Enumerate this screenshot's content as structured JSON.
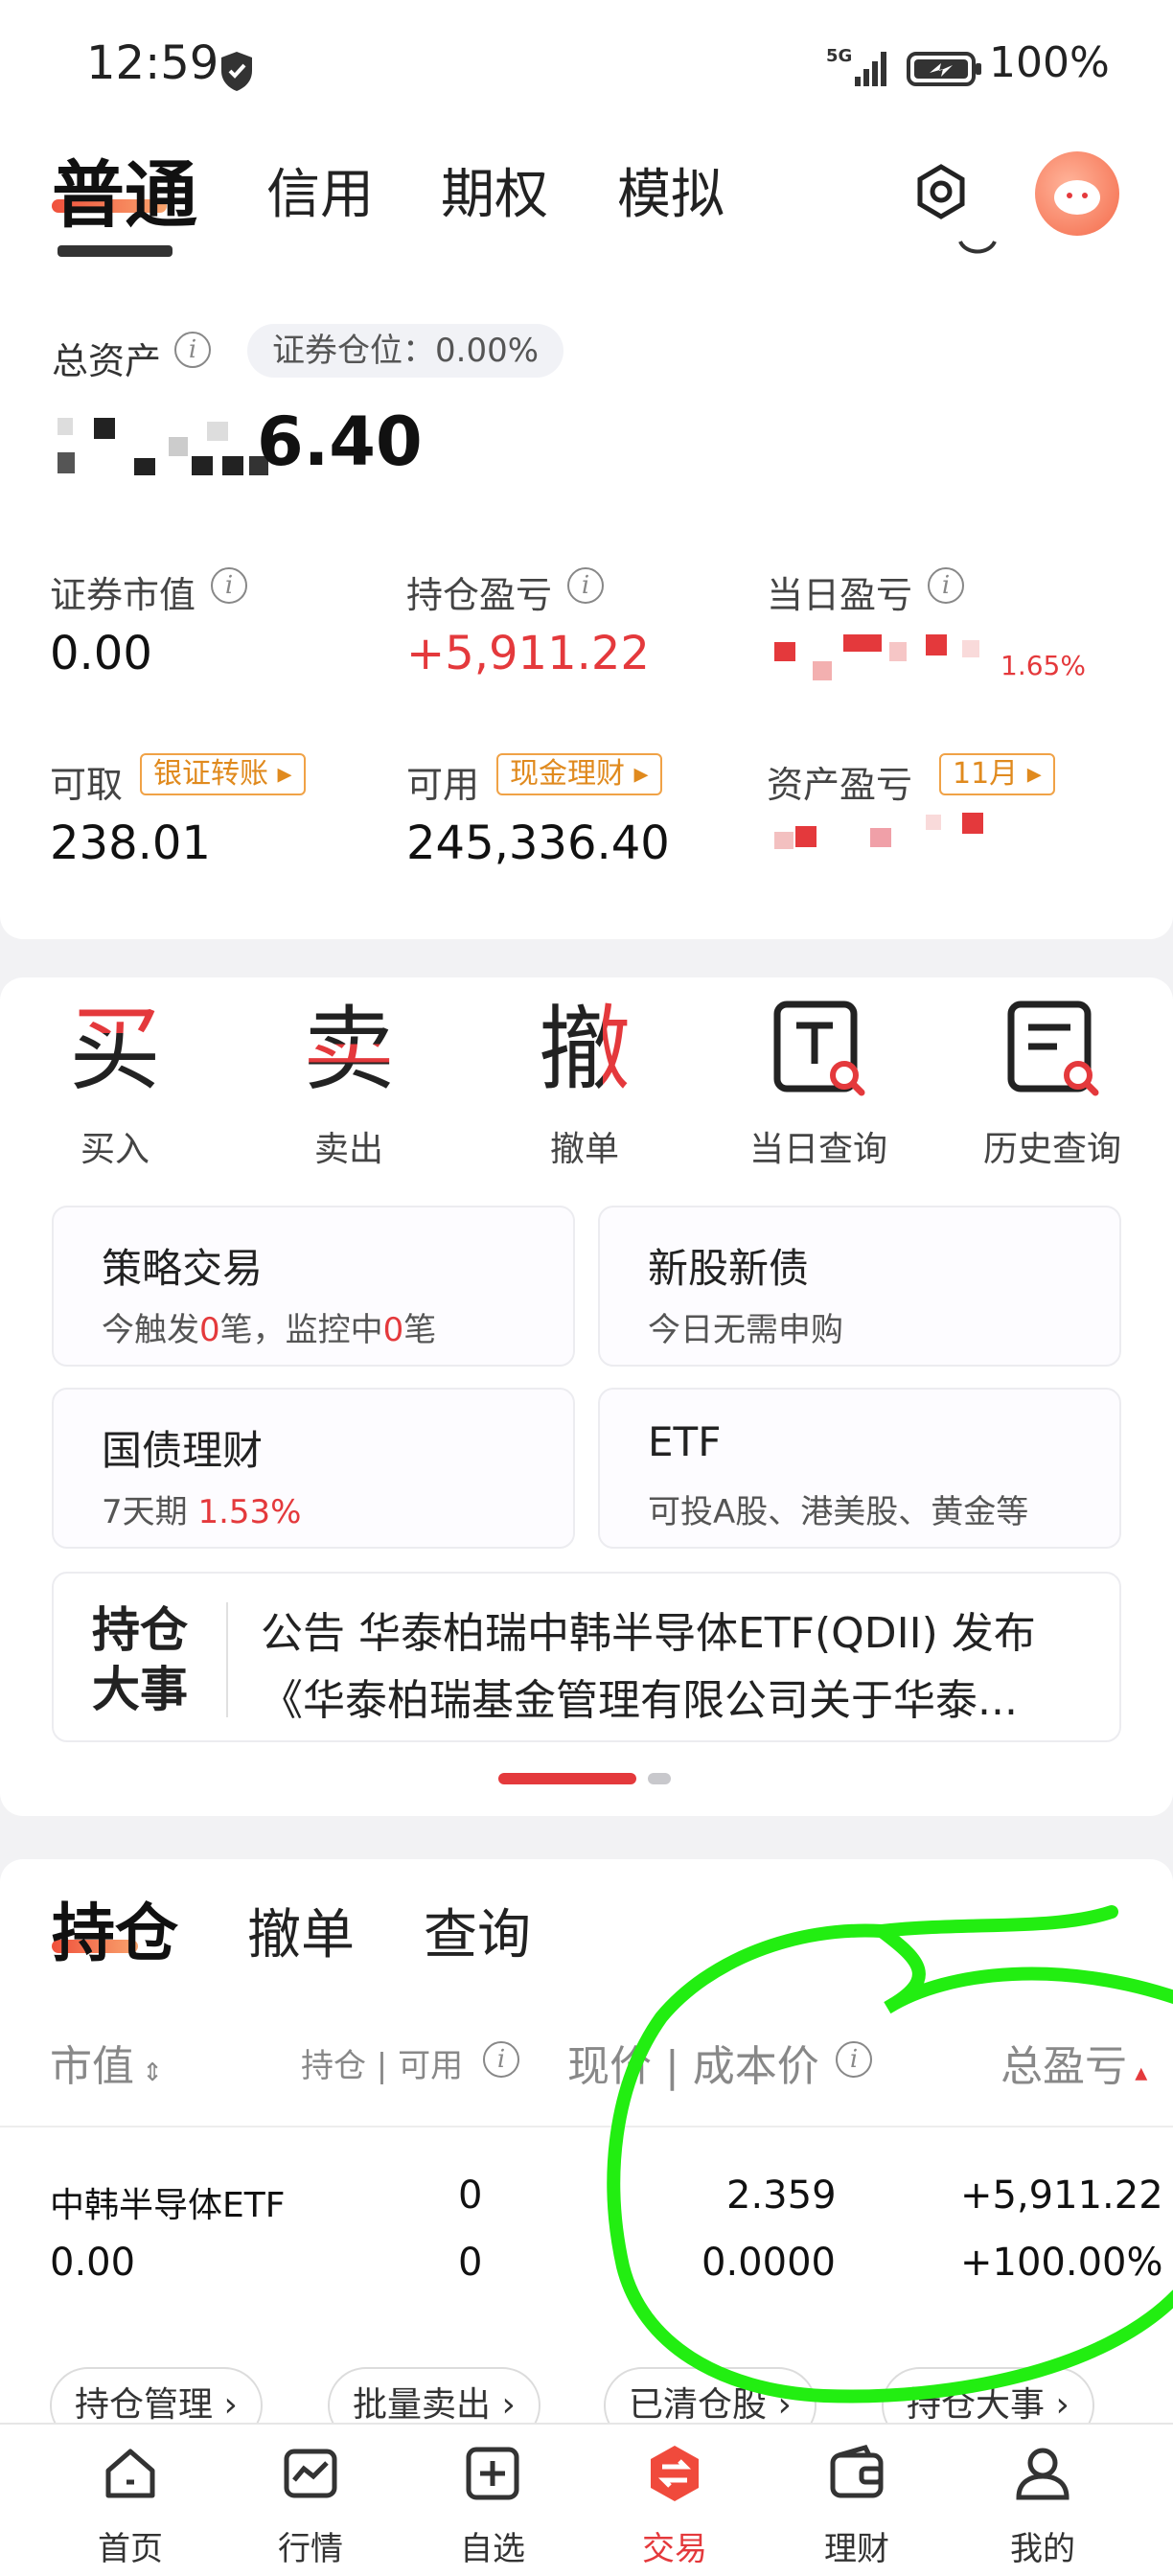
{
  "status_bar": {
    "time": "12:59",
    "network": "5G",
    "battery": "100%"
  },
  "top_tabs": [
    "普通",
    "信用",
    "期权",
    "模拟"
  ],
  "assets": {
    "total_label": "总资产",
    "position_pill": "证券仓位：0.00%",
    "total_value_visible": "6.40",
    "stats": [
      {
        "label": "证券市值",
        "value": "0.00"
      },
      {
        "label": "持仓盈亏",
        "value": "+5,911.22"
      },
      {
        "label": "当日盈亏",
        "value_tail": "1.65%"
      },
      {
        "label": "可取",
        "tag": "银证转账",
        "value": "238.01"
      },
      {
        "label": "可用",
        "tag": "现金理财",
        "value": "245,336.40"
      },
      {
        "label": "资产盈亏",
        "tag": "11月"
      }
    ]
  },
  "actions": [
    {
      "glyph": "买",
      "label": "买入"
    },
    {
      "glyph": "卖",
      "label": "卖出"
    },
    {
      "glyph": "撤",
      "label": "撤单"
    },
    {
      "label": "当日查询",
      "icon": "t-search-icon"
    },
    {
      "label": "历史查询",
      "icon": "doc-search-icon"
    }
  ],
  "tiles": [
    {
      "title": "策略交易",
      "sub_parts": [
        "今触发",
        "0",
        "笔，监控中",
        "0",
        "笔"
      ]
    },
    {
      "title": "新股新债",
      "sub": "今日无需申购"
    },
    {
      "title": "国债理财",
      "sub_a": "7天期 ",
      "sub_b": "1.53%"
    },
    {
      "title": "ETF",
      "sub": "可投A股、港美股、黄金等"
    }
  ],
  "news": {
    "badge_line1": "持仓",
    "badge_line2": "大事",
    "line1": "公告 华泰柏瑞中韩半导体ETF(QDII) 发布",
    "line2": "《华泰柏瑞基金管理有限公司关于华泰..."
  },
  "holdings": {
    "tabs": [
      "持仓",
      "撤单",
      "查询"
    ],
    "columns": {
      "market_value": "市值",
      "position": "持仓",
      "available": "可用",
      "price": "现价",
      "cost": "成本价",
      "total_pl": "总盈亏"
    },
    "row": {
      "name": "中韩半导体ETF",
      "market_value": "0.00",
      "position": "0",
      "available": "0",
      "price": "2.359",
      "cost": "0.0000",
      "total_pl": "+5,911.22",
      "total_pl_pct": "+100.00%"
    },
    "actions": [
      "持仓管理",
      "批量卖出",
      "已清仓股",
      "持仓大事"
    ]
  },
  "bottom_nav": [
    {
      "label": "首页",
      "icon": "home-icon"
    },
    {
      "label": "行情",
      "icon": "chart-icon"
    },
    {
      "label": "自选",
      "icon": "add-square-icon"
    },
    {
      "label": "交易",
      "icon": "trade-icon",
      "active": true
    },
    {
      "label": "理财",
      "icon": "wallet-icon"
    },
    {
      "label": "我的",
      "icon": "user-icon"
    }
  ],
  "colors": {
    "red": "#e4393c",
    "orange_tag": "#e08a1e",
    "annotation_green": "#22ee11"
  }
}
